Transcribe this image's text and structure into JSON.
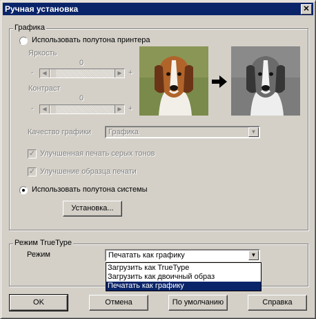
{
  "window": {
    "title": "Ручная установка",
    "close_glyph": "✕"
  },
  "graphics": {
    "group_label": "Графика",
    "printer_halftone_radio": "Использовать полутона принтера",
    "brightness": {
      "label": "Яркость",
      "value": "0",
      "minus": "-",
      "plus": "+"
    },
    "contrast": {
      "label": "Контраст",
      "value": "0",
      "minus": "-",
      "plus": "+"
    },
    "quality": {
      "label": "Качество графики",
      "selected": "Графика"
    },
    "gray_check": "Улучшенная печать серых тонов",
    "sample_check": "Улучшение образца печати",
    "system_halftone_radio": "Использовать полутона системы",
    "setup_button": "Установка...",
    "arrow_icon": "arrow-right-icon",
    "selected_radio": "system"
  },
  "truetype": {
    "group_label": "Режим TrueType",
    "mode_label": "Режим",
    "selected": "Печатать как графику",
    "options": [
      "Загрузить как TrueType",
      "Загрузить как двоичный образ",
      "Печатать как графику"
    ]
  },
  "buttons": {
    "ok": "OK",
    "cancel": "Отмена",
    "default": "По умолчанию",
    "help": "Справка"
  },
  "colors": {
    "titlebar": "#0a246a",
    "face": "#d4d0c8",
    "selection": "#0a246a"
  }
}
